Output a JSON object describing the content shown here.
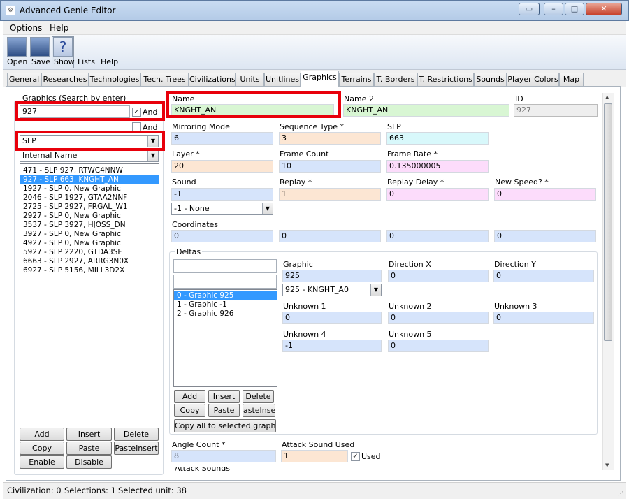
{
  "window": {
    "title": "Advanced Genie Editor"
  },
  "menu": [
    "Options",
    "Help"
  ],
  "toolbar": {
    "open": "Open",
    "save": "Save",
    "show": "Show",
    "lists": "Lists",
    "help": "Help",
    "show_icon": "?"
  },
  "tabs": [
    "General",
    "Researches",
    "Technologies",
    "Tech. Trees",
    "Civilizations",
    "Units",
    "Unitlines",
    "Graphics",
    "Terrains",
    "T. Borders",
    "T. Restrictions",
    "Sounds",
    "Player Colors",
    "Map"
  ],
  "active_tab": "Graphics",
  "left": {
    "search_label": "Graphics  (Search by enter)",
    "search_value": "927",
    "and1": "And",
    "and2": "And",
    "filter_select": "SLP",
    "sort_select": "Internal Name",
    "items": [
      "471 - SLP 927, RTWC4NNW",
      "927 - SLP 663, KNGHT_AN",
      "1927 - SLP 0, New Graphic",
      "2046 - SLP 1927, GTAA2NNF",
      "2725 - SLP 2927, FRGAL_W1",
      "2927 - SLP 0, New Graphic",
      "3537 - SLP 3927, HJOSS_DN",
      "3927 - SLP 0, New Graphic",
      "4927 - SLP 0, New Graphic",
      "5927 - SLP 2220, GTDA3SF",
      "6663 - SLP 2927, ARRG3N0X",
      "6927 - SLP 5156, MILL3D2X"
    ],
    "selected_index": 1,
    "buttons": {
      "add": "Add",
      "insert": "Insert",
      "delete": "Delete",
      "copy": "Copy",
      "paste": "Paste",
      "pasteinsert": "PasteInsert",
      "enable": "Enable",
      "disable": "Disable"
    }
  },
  "form": {
    "name_label": "Name",
    "name_value": "KNGHT_AN",
    "name2_label": "Name 2",
    "name2_value": "KNGHT_AN",
    "id_label": "ID",
    "id_value": "927",
    "mirroring_label": "Mirroring Mode",
    "mirroring_value": "6",
    "sequence_label": "Sequence Type *",
    "sequence_value": "3",
    "slp_label": "SLP",
    "slp_value": "663",
    "layer_label": "Layer *",
    "layer_value": "20",
    "framecount_label": "Frame Count",
    "framecount_value": "10",
    "framerate_label": "Frame Rate *",
    "framerate_value": "0.135000005",
    "sound_label": "Sound",
    "sound_value": "-1",
    "sound_select": "-1 - None",
    "replay_label": "Replay *",
    "replay_value": "1",
    "replaydelay_label": "Replay Delay *",
    "replaydelay_value": "0",
    "newspeed_label": "New Speed? *",
    "newspeed_value": "0",
    "coords_label": "Coordinates",
    "coords": [
      "0",
      "0",
      "0",
      "0"
    ],
    "anglecount_label": "Angle Count *",
    "anglecount_value": "8",
    "attacksound_label": "Attack Sound Used",
    "attacksound_value": "1",
    "used_label": "Used",
    "attacksounds_label": "Attack Sounds"
  },
  "deltas": {
    "label": "Deltas",
    "items": [
      "0 - Graphic 925",
      "1 - Graphic -1",
      "2 - Graphic 926"
    ],
    "selected_index": 0,
    "graphic_label": "Graphic",
    "graphic_value": "925",
    "graphic_select": "925 - KNGHT_A0",
    "dirx_label": "Direction X",
    "dirx_value": "0",
    "diry_label": "Direction Y",
    "diry_value": "0",
    "unk1_label": "Unknown 1",
    "unk1_value": "0",
    "unk2_label": "Unknown 2",
    "unk2_value": "0",
    "unk3_label": "Unknown 3",
    "unk3_value": "0",
    "unk4_label": "Unknown 4",
    "unk4_value": "-1",
    "unk5_label": "Unknown 5",
    "unk5_value": "0",
    "buttons": {
      "add": "Add",
      "insert": "Insert",
      "delete": "Delete",
      "copy": "Copy",
      "paste": "Paste",
      "pasteinsert": "asteInser",
      "copyall": "Copy all to selected graphics"
    }
  },
  "status": {
    "civ": "Civilization: 0",
    "selections": "Selections: 1",
    "unit": "Selected unit: 38"
  },
  "colors": {
    "highlight": "#e8000b",
    "selection": "#3399ff"
  }
}
